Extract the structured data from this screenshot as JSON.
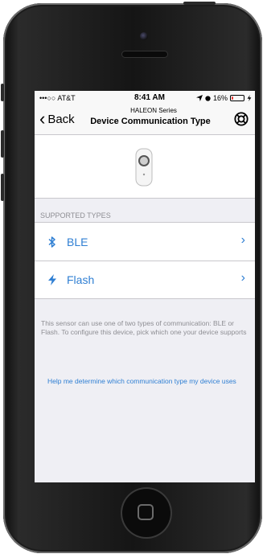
{
  "status_bar": {
    "carrier": "•••○○ AT&T",
    "time": "8:41 AM",
    "battery_percent": "16%",
    "battery_level": 0.16
  },
  "nav": {
    "back_label": "Back",
    "subtitle": "HALEON Series",
    "title": "Device Communication Type"
  },
  "section_header": "SUPPORTED TYPES",
  "types": [
    {
      "label": "BLE",
      "icon": "bluetooth-icon"
    },
    {
      "label": "Flash",
      "icon": "lightning-icon"
    }
  ],
  "description": "This sensor can use one of two types of communication: BLE or Flash. To configure this device, pick which one your device supports",
  "help_link": "Help me determine which communication type my device uses",
  "colors": {
    "accent": "#2f7fd3",
    "background": "#efeff4",
    "secondary_text": "#8e8e93",
    "battery_low": "#e53935"
  }
}
